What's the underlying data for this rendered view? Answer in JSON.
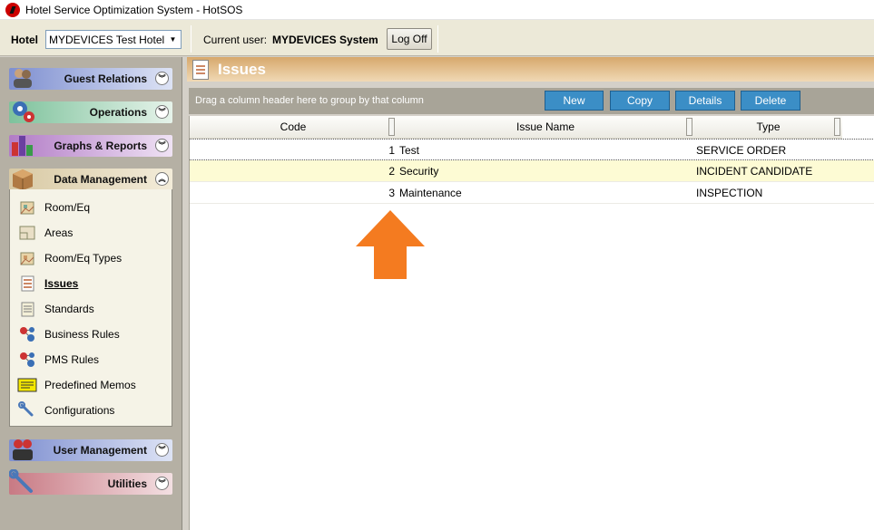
{
  "window": {
    "title": "Hotel Service Optimization System - HotSOS"
  },
  "toolbar": {
    "hotel_label": "Hotel",
    "hotel_value": "MYDEVICES Test Hotel",
    "user_label": "Current user:",
    "user_name": "MYDEVICES System",
    "logoff_label": "Log Off"
  },
  "sidebar": {
    "sections": {
      "guest": "Guest Relations",
      "operations": "Operations",
      "graphs": "Graphs & Reports",
      "data": "Data Management",
      "usermgmt": "User Management",
      "utilities": "Utilities"
    },
    "data_items": [
      {
        "label": "Room/Eq",
        "icon": "room-eq-icon"
      },
      {
        "label": "Areas",
        "icon": "areas-icon"
      },
      {
        "label": "Room/Eq Types",
        "icon": "room-eq-types-icon"
      },
      {
        "label": "Issues",
        "icon": "issues-icon"
      },
      {
        "label": "Standards",
        "icon": "standards-icon"
      },
      {
        "label": "Business Rules",
        "icon": "business-rules-icon"
      },
      {
        "label": "PMS Rules",
        "icon": "pms-rules-icon"
      },
      {
        "label": "Predefined Memos",
        "icon": "memo-icon"
      },
      {
        "label": "Configurations",
        "icon": "wrench-icon"
      }
    ],
    "active_item": "Issues"
  },
  "content": {
    "title": "Issues",
    "group_hint": "Drag a column header here to group by that column",
    "buttons": {
      "new": "New",
      "copy": "Copy",
      "details": "Details",
      "delete": "Delete"
    },
    "columns": {
      "code": "Code",
      "issue_name": "Issue Name",
      "type": "Type"
    },
    "rows": [
      {
        "code": "1",
        "name": "Test",
        "type": "SERVICE ORDER"
      },
      {
        "code": "2",
        "name": "Security",
        "type": "INCIDENT CANDIDATE"
      },
      {
        "code": "3",
        "name": "Maintenance",
        "type": "INSPECTION"
      }
    ]
  },
  "colors": {
    "button_blue": "#3b8ec6",
    "header_orange": "#d7a86c",
    "alt_row": "#fdfbd4",
    "arrow": "#f47b20"
  }
}
